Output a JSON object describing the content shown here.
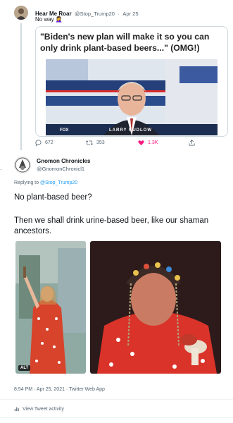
{
  "top_tweet": {
    "name": "Hear Me Roar",
    "handle": "@Stop_Trump20",
    "dot": "·",
    "date": "Apr 25",
    "text": "No way",
    "emoji": "🤦‍♀️",
    "card_headline": "\"Biden's new plan will make it so you can only drink plant-based beers...\" (OMG!)",
    "chyron": "LARRY KUDLOW",
    "network": "FOX",
    "actions": {
      "reply_count": "672",
      "retweet_count": "353",
      "like_count": "1.3K"
    },
    "colors": {
      "like": "#f91880"
    }
  },
  "main_tweet": {
    "name": "Gnomon Chronicles",
    "handle": "@GnomonChronicl1",
    "replying_prefix": "Replying to",
    "replying_to": "@Stop_Trump20",
    "line1": "No plant-based beer?",
    "line2": "Then we shall drink urine-based beer, like our shaman ancestors.",
    "alt_badge": "ALT",
    "timestamp": "8:54 PM · Apr 25, 2021 · Twitter Web App",
    "view_activity": "View Tweet activity"
  }
}
